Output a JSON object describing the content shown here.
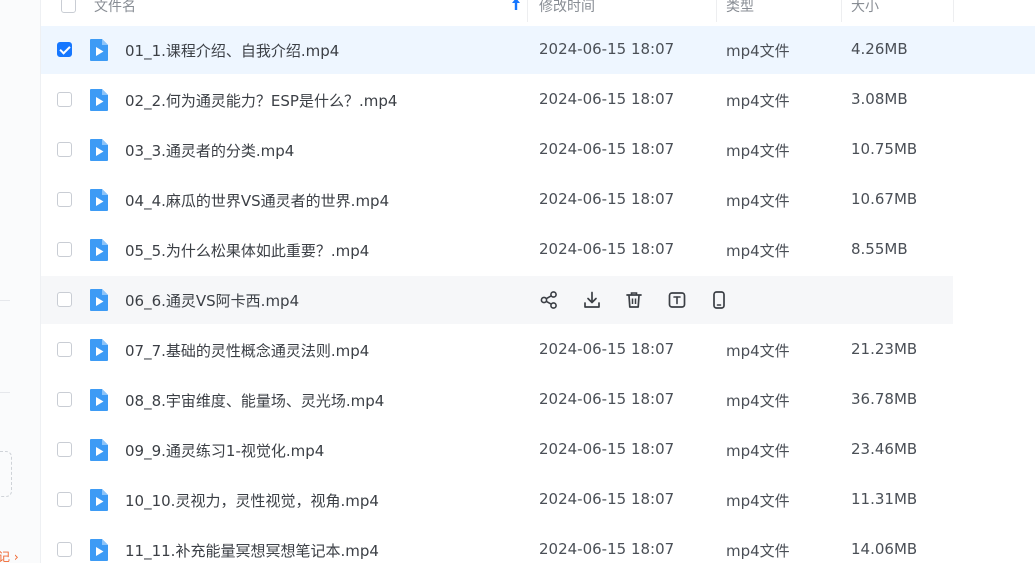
{
  "sidebar": {
    "partial_text": "记 ›"
  },
  "header": {
    "name_label": "文件名",
    "time_label": "修改时间",
    "type_label": "类型",
    "size_label": "大小"
  },
  "rows": [
    {
      "name": "01_1.课程介绍、自我介绍.mp4",
      "time": "2024-06-15 18:07",
      "type": "mp4文件",
      "size": "4.26MB"
    },
    {
      "name": "02_2.何为通灵能力？ESP是什么？.mp4",
      "time": "2024-06-15 18:07",
      "type": "mp4文件",
      "size": "3.08MB"
    },
    {
      "name": "03_3.通灵者的分类.mp4",
      "time": "2024-06-15 18:07",
      "type": "mp4文件",
      "size": "10.75MB"
    },
    {
      "name": "04_4.麻瓜的世界VS通灵者的世界.mp4",
      "time": "2024-06-15 18:07",
      "type": "mp4文件",
      "size": "10.67MB"
    },
    {
      "name": "05_5.为什么松果体如此重要？.mp4",
      "time": "2024-06-15 18:07",
      "type": "mp4文件",
      "size": "8.55MB"
    },
    {
      "name": "06_6.通灵VS阿卡西.mp4"
    },
    {
      "name": "07_7.基础的灵性概念通灵法则.mp4",
      "time": "2024-06-15 18:07",
      "type": "mp4文件",
      "size": "21.23MB"
    },
    {
      "name": "08_8.宇宙维度、能量场、灵光场.mp4",
      "time": "2024-06-15 18:07",
      "type": "mp4文件",
      "size": "36.78MB"
    },
    {
      "name": "09_9.通灵练习1-视觉化.mp4",
      "time": "2024-06-15 18:07",
      "type": "mp4文件",
      "size": "23.46MB"
    },
    {
      "name": "10_10.灵视力，灵性视觉，视角.mp4",
      "time": "2024-06-15 18:07",
      "type": "mp4文件",
      "size": "11.31MB"
    },
    {
      "name": "11_11.补充能量冥想冥想笔记本.mp4",
      "time": "2024-06-15 18:07",
      "type": "mp4文件",
      "size": "14.06MB"
    }
  ],
  "icons": {
    "file": "video-file-icon",
    "share": "share-icon",
    "download": "download-icon",
    "delete": "trash-icon",
    "rename": "rename-icon",
    "phone": "phone-icon"
  },
  "colors": {
    "accent": "#1677ff",
    "file_icon": "#3d9bf5",
    "selected_row": "#eef6ff"
  }
}
